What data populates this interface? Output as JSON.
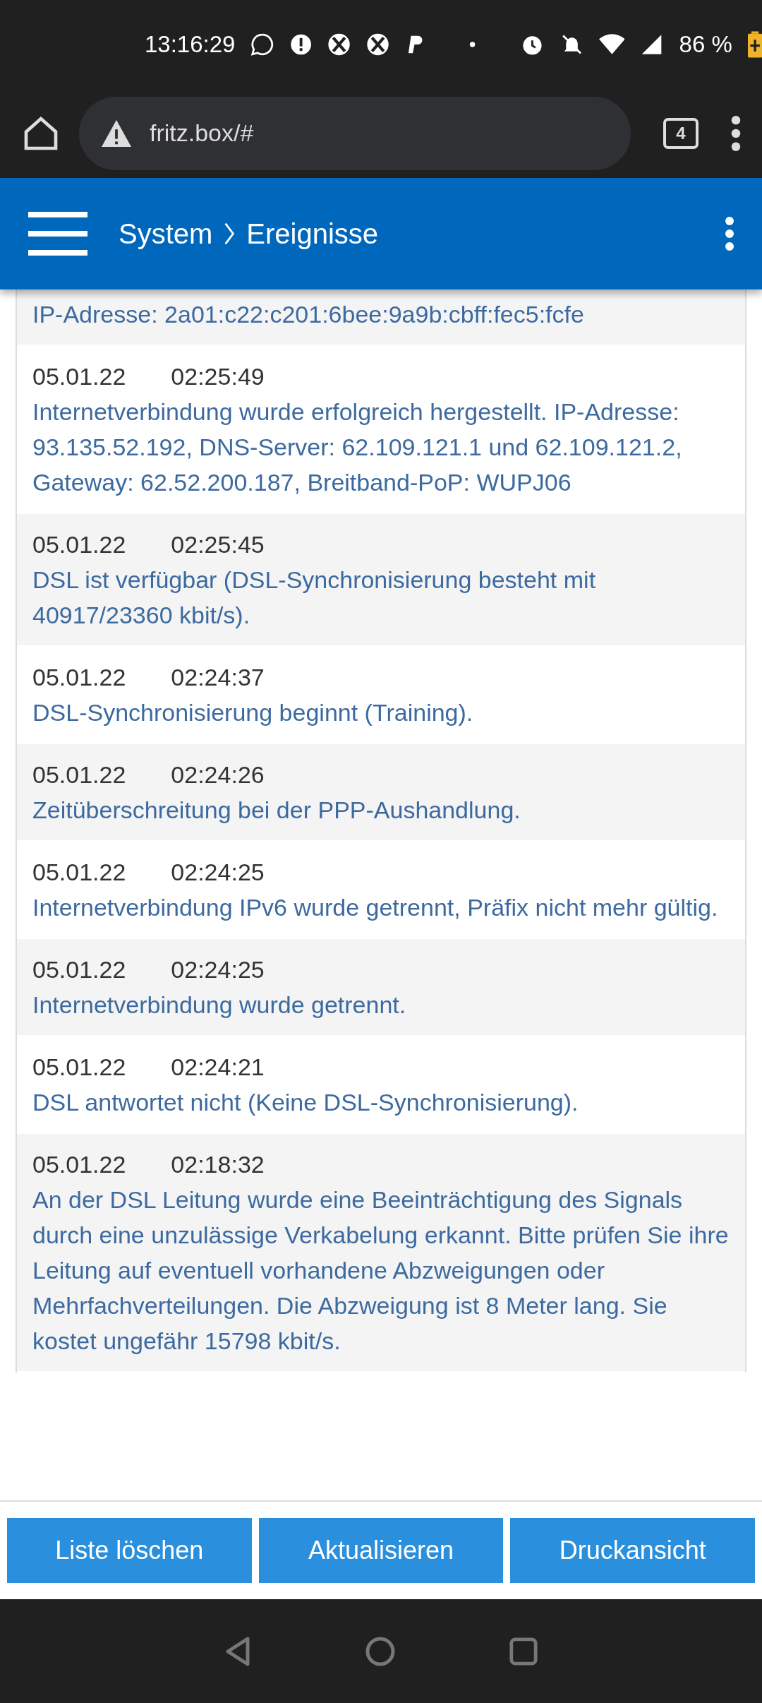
{
  "status_bar": {
    "time": "13:16:29",
    "battery": "86 %"
  },
  "browser": {
    "url": "fritz.box/#",
    "tab_count": "4"
  },
  "header": {
    "breadcrumb": [
      "System",
      "Ereignisse"
    ]
  },
  "events": [
    {
      "message": "IP-Adresse: 2a01:c22:c201:6bee:9a9b:cbff:fec5:fcfe"
    },
    {
      "date": "05.01.22",
      "time": "02:25:49",
      "message": "Internetverbindung wurde erfolgreich hergestellt. IP-Adresse: 93.135.52.192, DNS-Server: 62.109.121.1 und 62.109.121.2, Gateway: 62.52.200.187, Breitband-PoP: WUPJ06"
    },
    {
      "date": "05.01.22",
      "time": "02:25:45",
      "message": "DSL ist verfügbar (DSL-Synchronisierung besteht mit 40917/23360 kbit/s)."
    },
    {
      "date": "05.01.22",
      "time": "02:24:37",
      "message": "DSL-Synchronisierung beginnt (Training)."
    },
    {
      "date": "05.01.22",
      "time": "02:24:26",
      "message": "Zeitüberschreitung bei der PPP-Aushandlung."
    },
    {
      "date": "05.01.22",
      "time": "02:24:25",
      "message": "Internetverbindung IPv6 wurde getrennt, Präfix nicht mehr gültig."
    },
    {
      "date": "05.01.22",
      "time": "02:24:25",
      "message": "Internetverbindung wurde getrennt."
    },
    {
      "date": "05.01.22",
      "time": "02:24:21",
      "message": "DSL antwortet nicht (Keine DSL-Synchronisierung)."
    },
    {
      "date": "05.01.22",
      "time": "02:18:32",
      "message": "An der DSL Leitung wurde eine Beeinträchtigung des Signals durch eine unzulässige Verkabelung erkannt. Bitte prüfen Sie ihre Leitung auf eventuell vorhandene Abzweigungen oder Mehrfachverteilungen. Die Abzweigung ist 8 Meter lang. Sie kostet ungefähr 15798 kbit/s."
    }
  ],
  "buttons": [
    "Liste löschen",
    "Aktualisieren",
    "Druckansicht"
  ]
}
